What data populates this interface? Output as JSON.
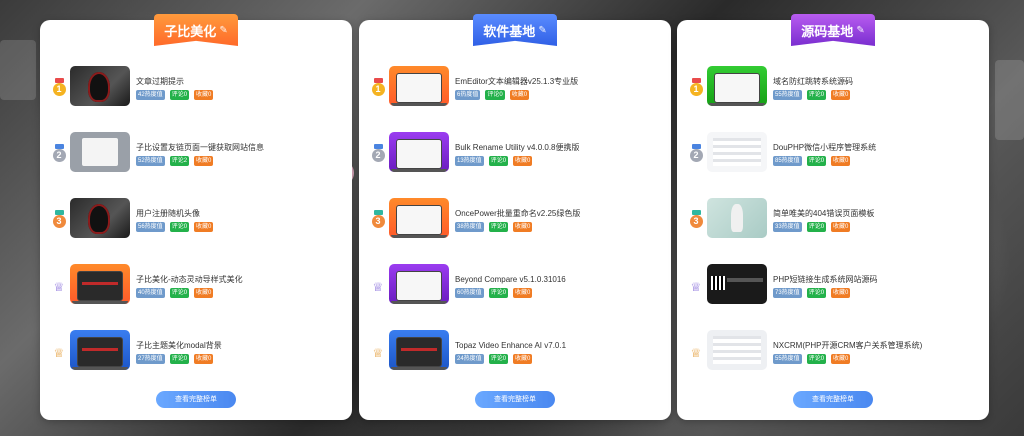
{
  "panels": [
    {
      "title": "子比美化",
      "button": "查看完整榜单",
      "items": [
        {
          "title": "文章过期提示",
          "hot": "42热度值",
          "rev": "评论0",
          "fav": "收藏0"
        },
        {
          "title": "子比设置友链页面一键获取网站信息",
          "hot": "52热度值",
          "rev": "评论2",
          "fav": "收藏0"
        },
        {
          "title": "用户注册随机头像",
          "hot": "56热度值",
          "rev": "评论0",
          "fav": "收藏0"
        },
        {
          "title": "子比美化-动态灵动导样式美化",
          "hot": "40热度值",
          "rev": "评论0",
          "fav": "收藏0"
        },
        {
          "title": "子比主题美化modal背景",
          "hot": "27热度值",
          "rev": "评论0",
          "fav": "收藏0"
        }
      ]
    },
    {
      "title": "软件基地",
      "button": "查看完整榜单",
      "items": [
        {
          "title": "EmEditor文本编辑器v25.1.3专业版",
          "hot": "6热度值",
          "rev": "评论0",
          "fav": "收藏0"
        },
        {
          "title": "Bulk Rename Utility v4.0.0.8便携版",
          "hot": "13热度值",
          "rev": "评论0",
          "fav": "收藏0"
        },
        {
          "title": "OncePower批量重命名v2.25绿色版",
          "hot": "38热度值",
          "rev": "评论0",
          "fav": "收藏0"
        },
        {
          "title": "Beyond Compare v5.1.0.31016",
          "hot": "60热度值",
          "rev": "评论0",
          "fav": "收藏0"
        },
        {
          "title": "Topaz Video Enhance AI v7.0.1",
          "hot": "24热度值",
          "rev": "评论0",
          "fav": "收藏0"
        }
      ]
    },
    {
      "title": "源码基地",
      "button": "查看完整榜单",
      "items": [
        {
          "title": "域名防红跳转系统源码",
          "hot": "55热度值",
          "rev": "评论0",
          "fav": "收藏0"
        },
        {
          "title": "DouPHP微信小程序管理系统",
          "hot": "85热度值",
          "rev": "评论0",
          "fav": "收藏0"
        },
        {
          "title": "简单唯美的404错误页面模板",
          "hot": "33热度值",
          "rev": "评论0",
          "fav": "收藏0"
        },
        {
          "title": "PHP短链接生成系统网站源码",
          "hot": "73热度值",
          "rev": "评论0",
          "fav": "收藏0"
        },
        {
          "title": "NXCRM(PHP开源CRM客户关系管理系统)",
          "hot": "55热度值",
          "rev": "评论0",
          "fav": "收藏0"
        }
      ]
    }
  ],
  "rank_labels": [
    "1",
    "2",
    "3"
  ],
  "icons": {
    "rank1": "gold-medal-icon",
    "rank2": "silver-medal-icon",
    "rank3": "bronze-medal-icon",
    "rank4": "purple-cup-icon",
    "rank5": "orange-cup-icon"
  },
  "colors": {
    "ribbon_1": "#ff7a2a",
    "ribbon_2": "#3f6ff0",
    "ribbon_3": "#9340e0",
    "tag_hot": "#6f9acb",
    "tag_review": "#23b14a",
    "tag_favorite": "#f07c24",
    "button": "#5a98f8"
  }
}
